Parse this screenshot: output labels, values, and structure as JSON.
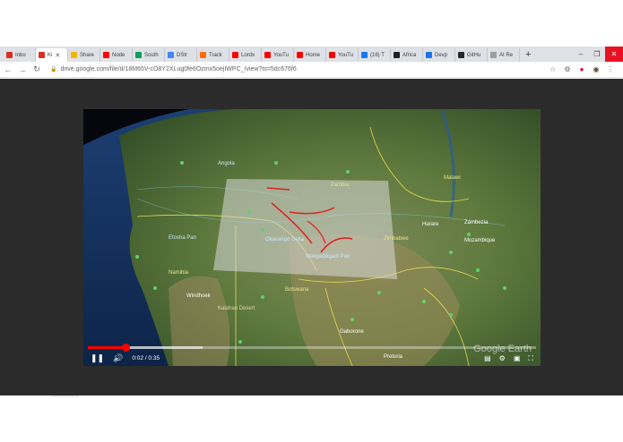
{
  "browser": {
    "tabs": [
      {
        "label": "Inbo",
        "color": "#d93025",
        "active": false
      },
      {
        "label": "Ki",
        "color": "#d93025",
        "active": true
      },
      {
        "label": "Share",
        "color": "#f4b400",
        "active": false
      },
      {
        "label": "Node",
        "color": "#ff0000",
        "active": false
      },
      {
        "label": "South",
        "color": "#0f9d58",
        "active": false
      },
      {
        "label": "DStr",
        "color": "#4285f4",
        "active": false
      },
      {
        "label": "Track",
        "color": "#ff6d00",
        "active": false
      },
      {
        "label": "Lordx",
        "color": "#ff0000",
        "active": false
      },
      {
        "label": "YouTu",
        "color": "#ff0000",
        "active": false
      },
      {
        "label": "Home",
        "color": "#ff0000",
        "active": false
      },
      {
        "label": "YouTu",
        "color": "#ff0000",
        "active": false
      },
      {
        "label": "(16) T",
        "color": "#1877f2",
        "active": false
      },
      {
        "label": "Africa",
        "color": "#202124",
        "active": false
      },
      {
        "label": "Devp",
        "color": "#1a73e8",
        "active": false
      },
      {
        "label": "GitHu",
        "color": "#24292e",
        "active": false
      },
      {
        "label": "AI Re",
        "color": "#9e9e9e",
        "active": false
      }
    ],
    "url": "drive.google.com/file/d/18M65V-cO8Y2XLug0fe6Ozmx5oejIWPC_/view?ts=5dc676f6"
  },
  "map": {
    "labels": {
      "angola": "Angola",
      "zambia": "Zambia",
      "malawi": "Malawi",
      "zambezia": "Zambezia",
      "mozambique": "Mozambique",
      "harare": "Harare",
      "zimbabwe": "Zimbabwe",
      "namibia": "Namibia",
      "windhoek": "Windhoek",
      "botswana": "Botswana",
      "gaborone": "Gaborone",
      "pretoria": "Pretoria",
      "etosha": "Etosha Pan",
      "okavango": "Okavango Delta",
      "makgadikgadi": "Makgadikgadi Pan",
      "kalahari": "Kalahari Desert"
    }
  },
  "player": {
    "time_current": "0:02",
    "time_total": "0:35",
    "progress": 0.083,
    "watermark": "Google Earth"
  }
}
